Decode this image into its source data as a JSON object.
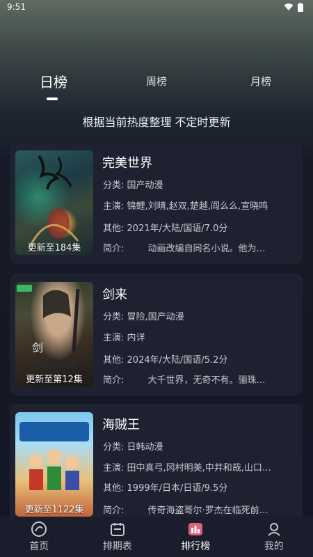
{
  "status_bar": {
    "time": "9:51"
  },
  "tabs": [
    {
      "label": "日榜"
    },
    {
      "label": "周榜"
    },
    {
      "label": "月榜"
    }
  ],
  "subtitle": "根据当前热度整理 不定时更新",
  "shows": [
    {
      "title": "完美世界",
      "category_label": "分类:",
      "category": "国产动漫",
      "cast_label": "主演:",
      "cast": "锦鲤,刘晴,赵双,楚越,阎么么,宣晓鸣",
      "other_label": "其他:",
      "other": "2021年/大陆/国语/7.0分",
      "intro_label": "简介:",
      "intro": "动画改编自同名小说。他为…",
      "episodes": "更新至184集"
    },
    {
      "title": "剑来",
      "category_label": "分类:",
      "category": "冒险,国产动漫",
      "cast_label": "主演:",
      "cast": "内详",
      "other_label": "其他:",
      "other": "2024年/大陆/国语/5.2分",
      "intro_label": "简介:",
      "intro": "大千世界，无奇不有。骊珠…",
      "episodes": "更新至第12集"
    },
    {
      "title": "海贼王",
      "category_label": "分类:",
      "category": "日韩动漫",
      "cast_label": "主演:",
      "cast": "田中真弓,冈村明美,中井和哉,山口…",
      "other_label": "其他:",
      "other": "1999年/日本/日语/9.5分",
      "intro_label": "简介:",
      "intro": "传奇海盗哥尔·罗杰在临死前…",
      "episodes": "更新至1122集"
    }
  ],
  "bottom_nav": [
    {
      "label": "首页",
      "icon": "home-icon"
    },
    {
      "label": "排期表",
      "icon": "calendar-icon"
    },
    {
      "label": "排行榜",
      "icon": "ranking-icon"
    },
    {
      "label": "我的",
      "icon": "profile-icon"
    }
  ],
  "colors": {
    "card_bg": "#1e2130",
    "nav_bg": "#1a1d2b",
    "ranking_accent": "#e0607a"
  }
}
